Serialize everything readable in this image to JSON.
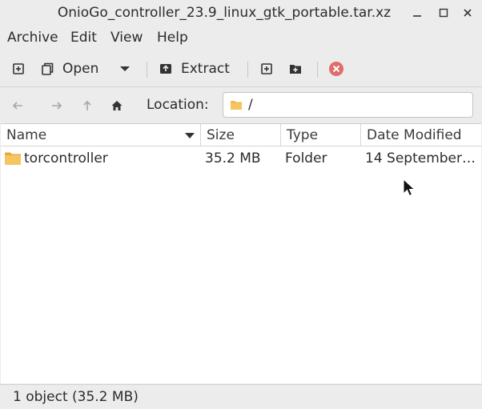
{
  "window": {
    "title": "OnioGo_controller_23.9_linux_gtk_portable.tar.xz"
  },
  "menubar": {
    "items": [
      "Archive",
      "Edit",
      "View",
      "Help"
    ]
  },
  "toolbar": {
    "open_label": "Open",
    "extract_label": "Extract"
  },
  "location": {
    "label": "Location:",
    "value": "/"
  },
  "columns": [
    "Name",
    "Size",
    "Type",
    "Date Modified"
  ],
  "files": [
    {
      "name": "torcontroller",
      "size": "35.2 MB",
      "type": "Folder",
      "modified": "14 September…"
    }
  ],
  "status": {
    "text": "1 object (35.2 MB)"
  },
  "colors": {
    "accent_close": "#e06c6c",
    "folder": "#f3b850"
  }
}
